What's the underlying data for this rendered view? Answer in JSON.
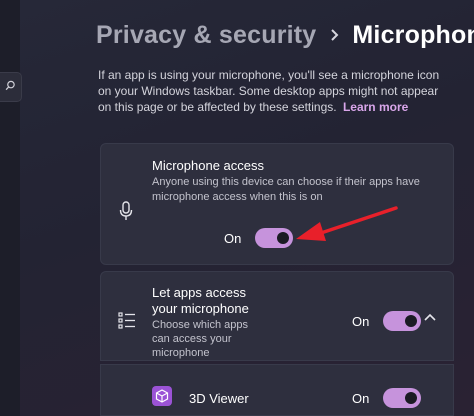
{
  "breadcrumb": {
    "parent": "Privacy & security",
    "current": "Microphone"
  },
  "description": {
    "text": "If an app is using your microphone, you'll see a microphone icon on your Windows taskbar. Some desktop apps might not appear on this page or be affected by these settings.",
    "link": "Learn more"
  },
  "microphone_access": {
    "icon": "microphone-icon",
    "title": "Microphone access",
    "subtitle": "Anyone using this device can choose if their apps have microphone access when this is on",
    "toggle_label": "On",
    "toggle_state": true
  },
  "let_apps_access": {
    "icon": "list-icon",
    "title_line1": "Let apps access",
    "title_line2": "your microphone",
    "subtitle_line1": "Choose which apps",
    "subtitle_line2": "can access your",
    "subtitle_line3": "microphone",
    "toggle_label": "On",
    "toggle_state": true,
    "expanded": true
  },
  "apps": [
    {
      "icon": "3d-viewer-icon",
      "name": "3D Viewer",
      "toggle_label": "On",
      "toggle_state": true
    }
  ],
  "colors": {
    "accent": "#c693dc",
    "link": "#d9a6ea",
    "arrow": "#e8202a",
    "card": "#2e2f3e"
  }
}
